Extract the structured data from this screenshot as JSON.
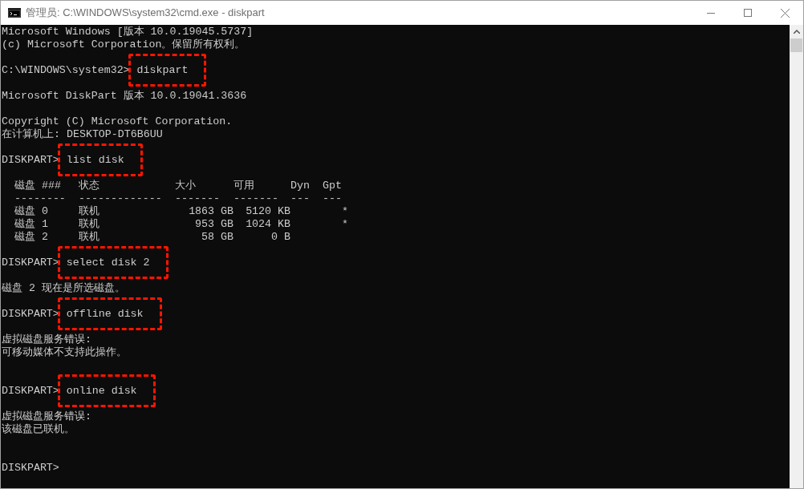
{
  "window": {
    "title": "管理员: C:\\WINDOWS\\system32\\cmd.exe - diskpart"
  },
  "lines": [
    {
      "kind": "output",
      "text": "Microsoft Windows [版本 10.0.19045.5737]"
    },
    {
      "kind": "output",
      "text": "(c) Microsoft Corporation。保留所有权利。"
    },
    {
      "kind": "blank"
    },
    {
      "kind": "command",
      "prompt": "C:\\WINDOWS\\system32>",
      "command": "diskpart",
      "highlighted": true
    },
    {
      "kind": "blank"
    },
    {
      "kind": "output",
      "text": "Microsoft DiskPart 版本 10.0.19041.3636"
    },
    {
      "kind": "blank"
    },
    {
      "kind": "output",
      "text": "Copyright (C) Microsoft Corporation."
    },
    {
      "kind": "output",
      "text": "在计算机上: DESKTOP-DT6B6UU"
    },
    {
      "kind": "blank"
    },
    {
      "kind": "command",
      "prompt": "DISKPART>",
      "command": "list disk",
      "highlighted": true
    },
    {
      "kind": "blank"
    },
    {
      "kind": "table",
      "columns": [
        {
          "label": "磁盘 ###",
          "rule": "--------"
        },
        {
          "label": "状态",
          "rule": "-------------"
        },
        {
          "label": "大小",
          "rule": "-------"
        },
        {
          "label": "可用",
          "rule": "-------"
        },
        {
          "label": "Dyn",
          "rule": "---"
        },
        {
          "label": "Gpt",
          "rule": "---"
        }
      ],
      "rows": [
        {
          "disk": "磁盘 0",
          "status": "联机",
          "size": "1863 GB",
          "free": "5120 KB",
          "gpt": "*"
        },
        {
          "disk": "磁盘 1",
          "status": "联机",
          "size": "953 GB",
          "free": "1024 KB",
          "gpt": "*"
        },
        {
          "disk": "磁盘 2",
          "status": "联机",
          "size": "58 GB",
          "free": "0 B"
        }
      ]
    },
    {
      "kind": "blank"
    },
    {
      "kind": "command",
      "prompt": "DISKPART>",
      "command": "select disk 2",
      "highlighted": true
    },
    {
      "kind": "blank"
    },
    {
      "kind": "output",
      "text": "磁盘 2 现在是所选磁盘。"
    },
    {
      "kind": "blank"
    },
    {
      "kind": "command",
      "prompt": "DISKPART>",
      "command": "offline disk",
      "highlighted": true
    },
    {
      "kind": "blank"
    },
    {
      "kind": "output",
      "text": "虚拟磁盘服务错误:"
    },
    {
      "kind": "output",
      "text": "可移动媒体不支持此操作。"
    },
    {
      "kind": "blank"
    },
    {
      "kind": "blank"
    },
    {
      "kind": "command",
      "prompt": "DISKPART>",
      "command": "online disk",
      "highlighted": true
    },
    {
      "kind": "blank"
    },
    {
      "kind": "output",
      "text": "虚拟磁盘服务错误:"
    },
    {
      "kind": "output",
      "text": "该磁盘已联机。"
    },
    {
      "kind": "blank"
    },
    {
      "kind": "blank"
    },
    {
      "kind": "command",
      "prompt": "DISKPART>"
    }
  ]
}
